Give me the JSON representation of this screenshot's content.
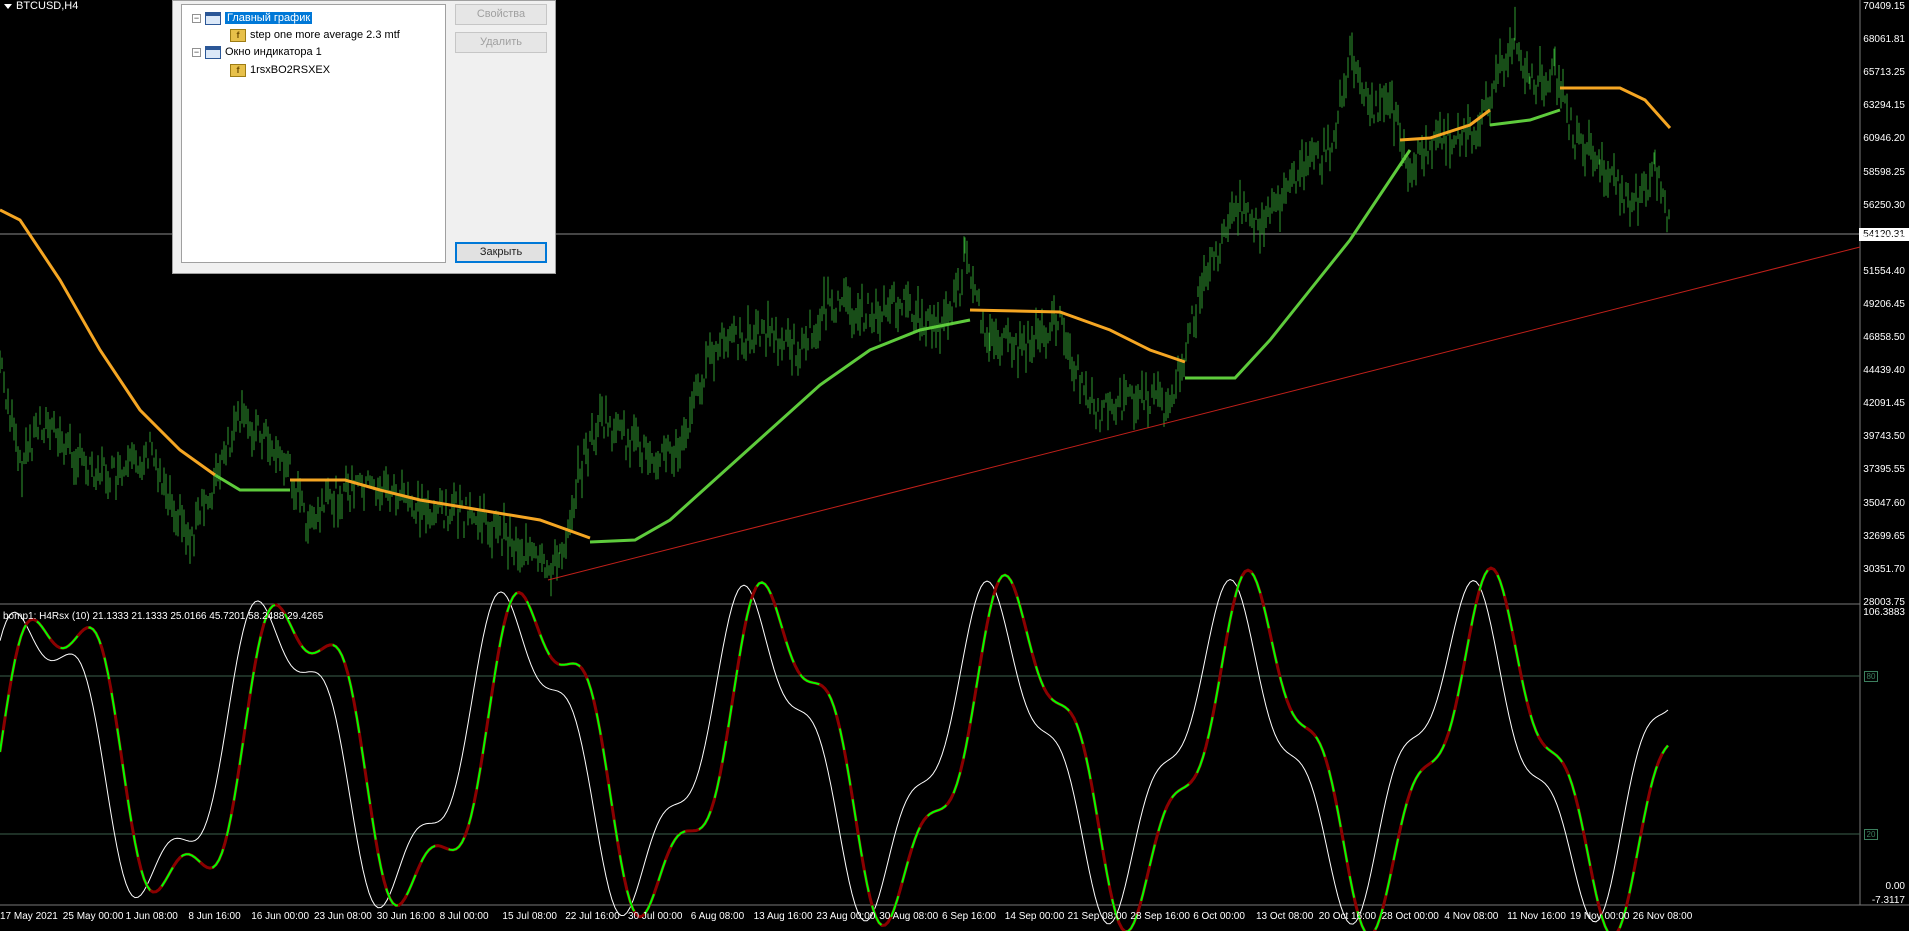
{
  "chart": {
    "symbol_title": "BTCUSD,H4",
    "current_price": "54120.31",
    "price_axis": [
      "70409.15",
      "68061.81",
      "65713.25",
      "63294.15",
      "60946.20",
      "58598.25",
      "56250.30",
      "53902.35",
      "51554.40",
      "49206.45",
      "46858.50",
      "44439.40",
      "42091.45",
      "39743.50",
      "37395.55",
      "35047.60",
      "32699.65",
      "30351.70",
      "28003.75"
    ],
    "subwindow_label": "bomp1: H4Rsx (10) 21.1333 21.1333 25.0166 45.7201 58.2488 29.4265",
    "subwindow_axis": [
      "106.3883",
      "80",
      "20",
      "0.00",
      "-7.3117"
    ],
    "time_axis": [
      "17 May 2021",
      "25 May 00:00",
      "1 Jun 08:00",
      "8 Jun 16:00",
      "16 Jun 00:00",
      "23 Jun 08:00",
      "30 Jun 16:00",
      "8 Jul 00:00",
      "15 Jul 08:00",
      "22 Jul 16:00",
      "30 Jul 00:00",
      "6 Aug 08:00",
      "13 Aug 16:00",
      "23 Aug 00:00",
      "30 Aug 08:00",
      "6 Sep 16:00",
      "14 Sep 00:00",
      "21 Sep 08:00",
      "28 Sep 16:00",
      "6 Oct 00:00",
      "13 Oct 08:00",
      "20 Oct 16:00",
      "28 Oct 00:00",
      "4 Nov 08:00",
      "11 Nov 16:00",
      "19 Nov 00:00",
      "26 Nov 08:00"
    ],
    "colors": {
      "bull_bar": "#2f9a2f",
      "ma_up": "#5ecb3c",
      "ma_down": "#f5a623",
      "trendline": "#c0201a",
      "rsx_up": "#00ff00",
      "rsx_down": "#8b0000",
      "signal": "#ffffff",
      "level": "#3c7f5e"
    }
  },
  "dialog": {
    "tree": [
      {
        "label": "Главный график",
        "type": "window",
        "selected": true
      },
      {
        "label": "step one more average 2.3 mtf",
        "type": "indicator"
      },
      {
        "label": "Окно индикатора 1",
        "type": "window"
      },
      {
        "label": "1rsxBO2RSXEX",
        "type": "indicator"
      }
    ],
    "properties_button": "Свойства",
    "delete_button": "Удалить",
    "close_button": "Закрыть"
  }
}
